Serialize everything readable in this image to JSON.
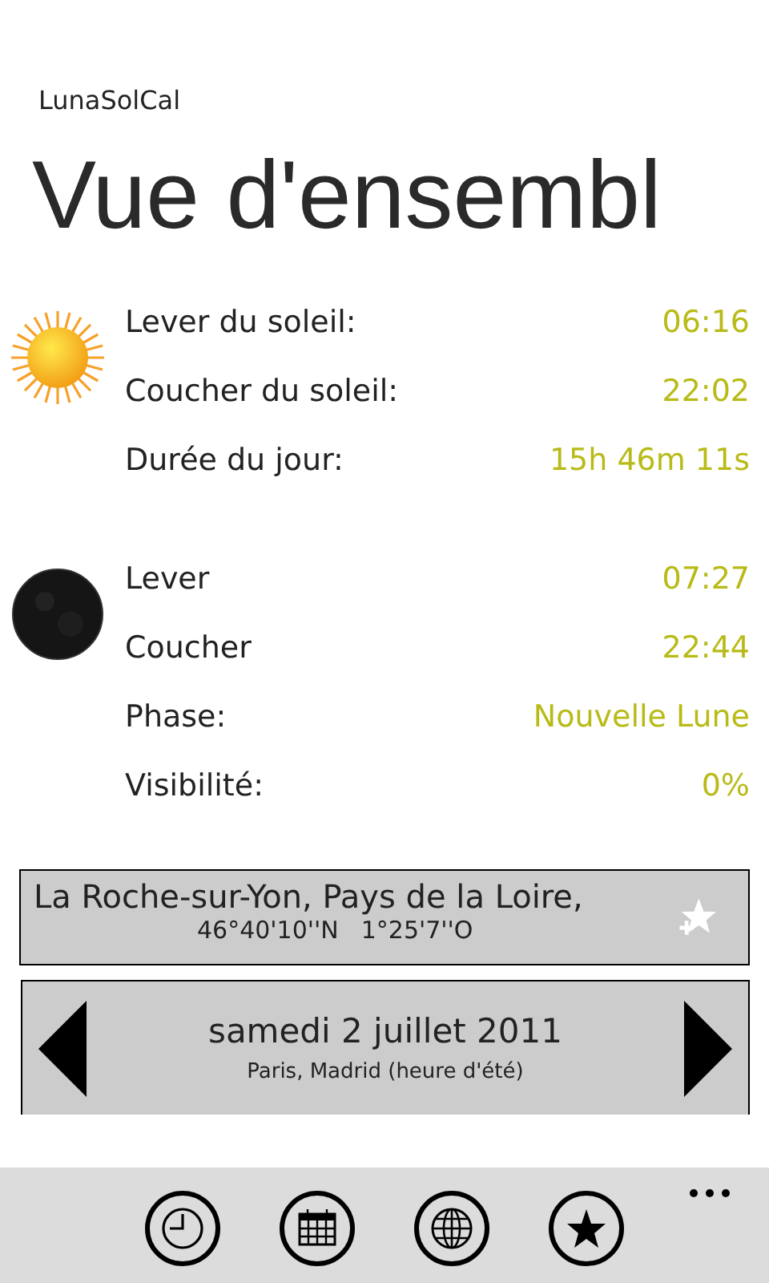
{
  "app_name": "LunaSolCal",
  "title": "Vue d'ensembl",
  "sun": [
    {
      "label": "Lever du soleil:",
      "value": "06:16"
    },
    {
      "label": "Coucher du soleil:",
      "value": "22:02"
    },
    {
      "label": "Durée du jour:",
      "value": "15h 46m 11s"
    }
  ],
  "moon": [
    {
      "label": "Lever",
      "value": "07:27"
    },
    {
      "label": "Coucher",
      "value": "22:44"
    },
    {
      "label": "Phase:",
      "value": "Nouvelle Lune"
    },
    {
      "label": "Visibilité:",
      "value": "0%"
    }
  ],
  "location": {
    "name": "La Roche-sur-Yon, Pays de la Loire,",
    "latitude": "46°40'10''N",
    "longitude": "1°25'7''O"
  },
  "date": {
    "label": "samedi 2 juillet 2011",
    "timezone": "Paris, Madrid (heure d'été)"
  }
}
